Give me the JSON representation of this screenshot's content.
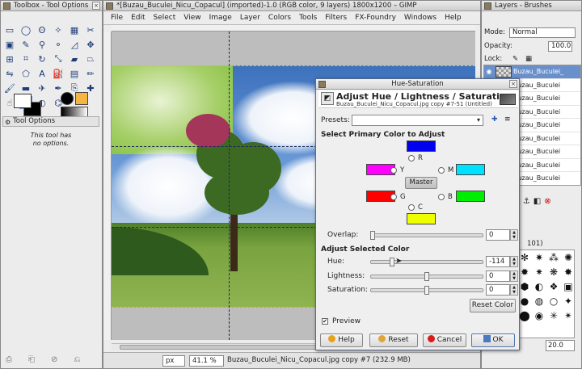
{
  "toolbox": {
    "title": "Toolbox - Tool Options",
    "tool_options_tab": "Tool Options",
    "no_options": "This tool has\nno options."
  },
  "image_window": {
    "title": "*[Buzau_Buculei_Nicu_Copacul] (imported)-1.0 (RGB color, 9 layers) 1800x1200 – GIMP",
    "menu": [
      "File",
      "Edit",
      "Select",
      "View",
      "Image",
      "Layer",
      "Colors",
      "Tools",
      "Filters",
      "FX-Foundry",
      "Windows",
      "Help"
    ],
    "status": {
      "unit": "px",
      "zoom": "41.1 %",
      "text": "Buzau_Buculei_Nicu_Copacul.jpg copy #7 (232.9 MB)"
    }
  },
  "layers_panel": {
    "title": "Layers - Brushes",
    "mode_label": "Mode:",
    "mode_value": "Normal",
    "opacity_label": "Opacity:",
    "opacity_value": "100.0",
    "lock_label": "Lock:",
    "layers": [
      {
        "name": "Buzau_Buculei_",
        "selected": true
      },
      {
        "name": "Buzau_Buculei",
        "selected": false
      },
      {
        "name": "Buzau_Buculei",
        "selected": false
      },
      {
        "name": "Buzau_Buculei",
        "selected": false
      },
      {
        "name": "Buzau_Buculei",
        "selected": false
      },
      {
        "name": "Buzau_Buculei",
        "selected": false
      },
      {
        "name": "Buzau_Buculei",
        "selected": false
      },
      {
        "name": "Buzau_Buculei",
        "selected": false
      },
      {
        "name": "Buzau_Buculei",
        "selected": false
      }
    ],
    "brush_header": "101)",
    "spacing_value": "20.0"
  },
  "dialog": {
    "title": "Hue-Saturation",
    "header_title": "Adjust Hue / Lightness / Saturation",
    "header_sub": "Buzau_Buculei_Nicu_Copacul.jpg copy #7-51 (Untitled)",
    "presets_label": "Presets:",
    "primary_heading": "Select Primary Color to Adjust",
    "radios": {
      "r": "R",
      "y": "Y",
      "m": "M",
      "g": "G",
      "b": "B",
      "c": "C"
    },
    "master_label": "Master",
    "overlap_label": "Overlap:",
    "overlap_value": "0",
    "adjust_heading": "Adjust Selected Color",
    "hue_label": "Hue:",
    "hue_value": "-114",
    "lightness_label": "Lightness:",
    "lightness_value": "0",
    "saturation_label": "Saturation:",
    "saturation_value": "0",
    "reset_color_label": "Reset Color",
    "preview_label": "Preview",
    "buttons": {
      "help": "Help",
      "reset": "Reset",
      "cancel": "Cancel",
      "ok": "OK"
    },
    "swatch_colors": {
      "r": "#0000ee",
      "y": "#ff00ff",
      "m": "#00e0ff",
      "g": "#ff0000",
      "b": "#00ee00",
      "c": "#eeff00"
    }
  }
}
